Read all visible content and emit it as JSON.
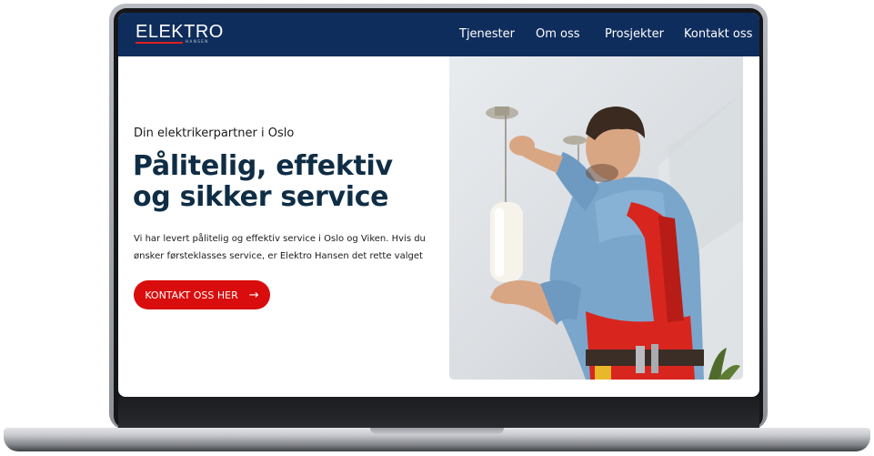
{
  "site": {
    "logo": "ELEKTRO",
    "logo_sub": "HANSEN"
  },
  "nav": {
    "items": [
      {
        "label": "Tjenester"
      },
      {
        "label": "Om oss"
      },
      {
        "label": "Prosjekter"
      },
      {
        "label": "Kontakt oss"
      }
    ]
  },
  "hero": {
    "tagline": "Din elektrikerpartner i Oslo",
    "headline_line1": "Pålitelig, effektiv",
    "headline_line2": "og sikker service",
    "desc_line1": "Vi har levert pålitelig og effektiv service i Oslo og Viken. Hvis du",
    "desc_line2": "ønsker førsteklasses service, er Elektro Hansen det rette valget",
    "cta_label": "KONTAKT OSS HER",
    "cta_icon": "arrow-right-icon"
  },
  "colors": {
    "nav_bg": "#0f2d5c",
    "accent": "#d90d0d",
    "headline": "#0f2d45"
  }
}
